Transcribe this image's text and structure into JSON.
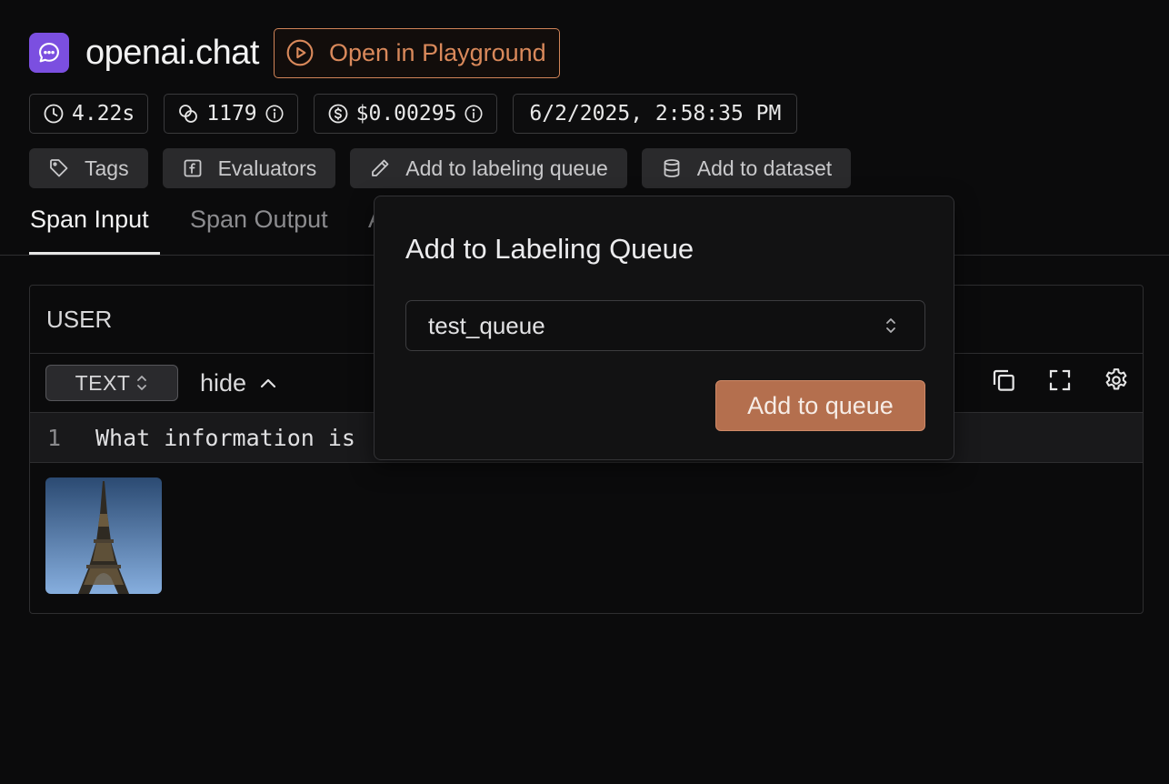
{
  "header": {
    "span_name": "openai.chat",
    "span_kind_icon": "chat-bubble-icon",
    "playground_label": "Open in Playground",
    "brand_color": "#7b4fe0",
    "accent_color": "#d9895b"
  },
  "metrics": {
    "latency": "4.22s",
    "tokens": "1179",
    "cost": "$0.00295",
    "timestamp": "6/2/2025, 2:58:35 PM"
  },
  "actions": {
    "tags": "Tags",
    "evaluators": "Evaluators",
    "labeling_queue": "Add to labeling queue",
    "dataset": "Add to dataset"
  },
  "tabs": [
    {
      "label": "Span Input",
      "active": true
    },
    {
      "label": "Span Output",
      "active": false
    },
    {
      "label": "A",
      "active": false
    }
  ],
  "message": {
    "role": "USER",
    "format": "TEXT",
    "toggle_label": "hide",
    "line_number": "1",
    "text": "What information is",
    "image_icon": "eiffel-tower-image"
  },
  "popover": {
    "title": "Add to Labeling Queue",
    "selected_queue": "test_queue",
    "submit_label": "Add to queue"
  }
}
